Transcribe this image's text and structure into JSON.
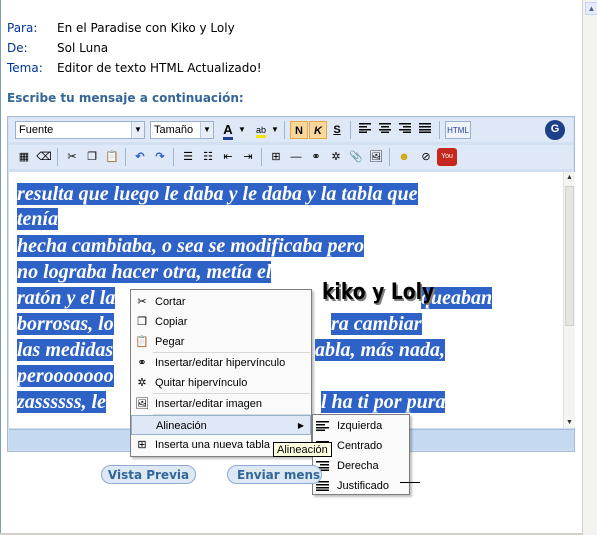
{
  "header": {
    "to_label": "Para:",
    "to_value": "En el Paradise con Kiko y Loly",
    "from_label": "De:",
    "from_value": "Sol Luna",
    "subject_label": "Tema:",
    "subject_value": "Editor de texto HTML Actualizado!"
  },
  "prompt": "Escribe tu mensaje a continuación:",
  "toolbar": {
    "font_select": "Fuente",
    "size_select": "Tamaño",
    "bold_label": "N",
    "italic_label": "K",
    "strike_label": "S",
    "html_label": "HTML",
    "profile_label": "G"
  },
  "content": {
    "lines": [
      "resulta que luego le daba y le daba y la tabla que",
      "tenía",
      "hecha cambiaba, o sea se modificaba pero",
      "no lograba hacer otra, metía el",
      "ratón y el la",
      "borrosas, lo",
      "las medidas",
      " perooooooo",
      " zassssss, le"
    ],
    "line_tails": {
      "ratón": "queaban",
      "borrosas": "ra cambiar",
      "medidas": "abla, más nada,",
      "zass": "l ha ti  por pura"
    },
    "watermark": "kiko y Loly"
  },
  "context_menu": {
    "items": [
      {
        "label": "Cortar",
        "icon": "scissors-icon"
      },
      {
        "label": "Copiar",
        "icon": "copy-icon"
      },
      {
        "label": "Pegar",
        "icon": "paste-icon"
      },
      {
        "label": "Insertar/editar hipervínculo",
        "icon": "link-icon"
      },
      {
        "label": "Quitar hipervínculo",
        "icon": "unlink-icon"
      },
      {
        "label": "Insertar/editar imagen",
        "icon": "image-icon"
      },
      {
        "label": "Alineación",
        "icon": ""
      },
      {
        "label": "Inserta una nueva tabla",
        "icon": "table-icon"
      }
    ]
  },
  "align_submenu": {
    "items": [
      "Izquierda",
      "Centrado",
      "Derecha",
      "Justificado"
    ]
  },
  "tooltip": "Alineación",
  "buttons": {
    "preview": "Vista Previa",
    "send": "Enviar mens"
  },
  "colors": {
    "highlight": "#2f62c6",
    "label_blue": "#003399",
    "toolbar_bg": "#dfe8f6"
  }
}
